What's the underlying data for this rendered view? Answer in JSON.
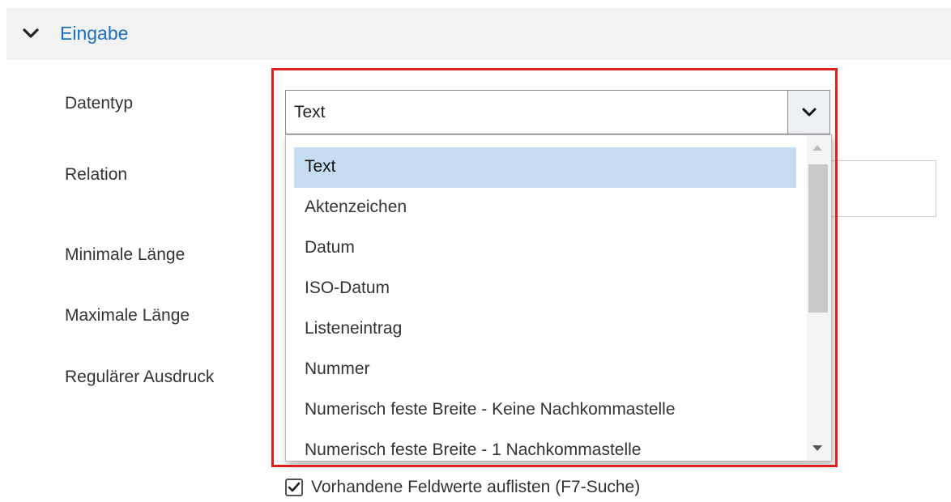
{
  "section": {
    "title": "Eingabe",
    "expanded": true,
    "chevron_icon": "chevron-down-icon"
  },
  "labels": {
    "datentyp": "Datentyp",
    "relation": "Relation",
    "min_length": "Minimale Länge",
    "max_length": "Maximale Länge",
    "regex": "Regulärer Ausdruck"
  },
  "datentyp_select": {
    "value": "Text",
    "toggle_icon": "chevron-down-icon",
    "options": [
      "Text",
      "Aktenzeichen",
      "Datum",
      "ISO-Datum",
      "Listeneintrag",
      "Nummer",
      "Numerisch feste Breite - Keine Nachkommastelle",
      "Numerisch feste Breite - 1 Nachkommastelle"
    ],
    "selected_index": 0
  },
  "checkbox": {
    "label": "Vorhandene Feldwerte auflisten (F7-Suche)",
    "checked": true
  },
  "colors": {
    "accent": "#1a6fbf",
    "highlight_frame": "#e02020",
    "selected_option_bg": "#c6ddf1",
    "header_bg": "#f2f2f2"
  }
}
